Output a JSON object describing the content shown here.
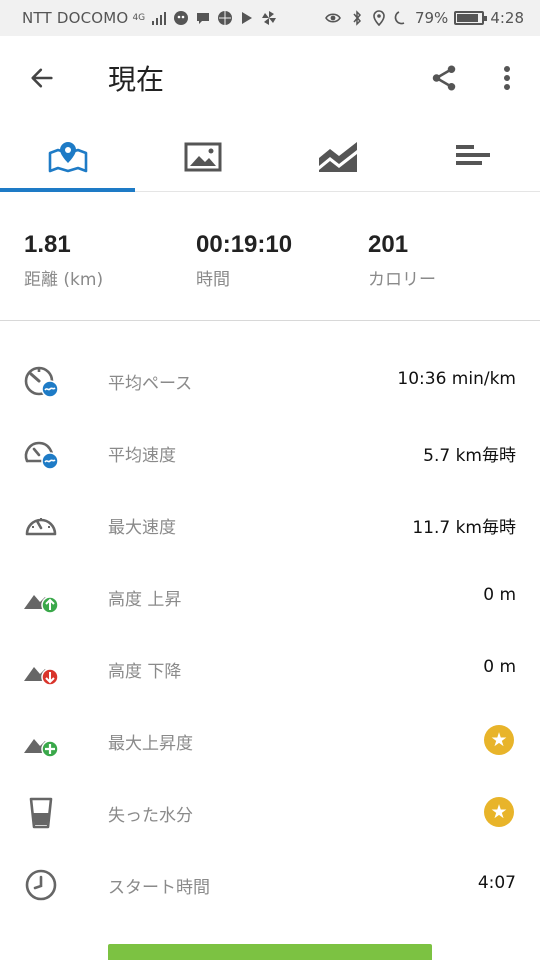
{
  "status_bar": {
    "carrier": "NTT DOCOMO",
    "network": "4G",
    "battery": "79%",
    "time": "4:28"
  },
  "header": {
    "title": "現在"
  },
  "tabs": [
    {
      "name": "map",
      "icon": "map-pin-icon",
      "active": true
    },
    {
      "name": "photos",
      "icon": "image-icon",
      "active": false
    },
    {
      "name": "charts",
      "icon": "area-chart-icon",
      "active": false
    },
    {
      "name": "laps",
      "icon": "bar-list-icon",
      "active": false
    }
  ],
  "summary": {
    "distance": {
      "value": "1.81",
      "label": "距離 (km)"
    },
    "duration": {
      "value": "00:19:10",
      "label": "時間"
    },
    "calories": {
      "value": "201",
      "label": "カロリー"
    }
  },
  "stats": [
    {
      "label": "平均ペース",
      "value": "10:36 min/km",
      "icon": "pace-icon"
    },
    {
      "label": "平均速度",
      "value": "5.7 km毎時",
      "icon": "avg-speed-icon"
    },
    {
      "label": "最大速度",
      "value": "11.7 km毎時",
      "icon": "speedometer-icon"
    },
    {
      "label": "高度 上昇",
      "value": "0 m",
      "icon": "elevation-up-icon"
    },
    {
      "label": "高度 下降",
      "value": "0 m",
      "icon": "elevation-down-icon"
    },
    {
      "label": "最大上昇度",
      "value": "",
      "icon": "max-elevation-icon",
      "premium": true
    },
    {
      "label": "失った水分",
      "value": "",
      "icon": "water-cup-icon",
      "premium": true
    },
    {
      "label": "スタート時間",
      "value": "4:07",
      "icon": "clock-icon"
    }
  ],
  "colors": {
    "accent": "#1e7bc6",
    "premium_star": "#e8b42a",
    "green": "#7cc242",
    "red": "#d9342b"
  }
}
